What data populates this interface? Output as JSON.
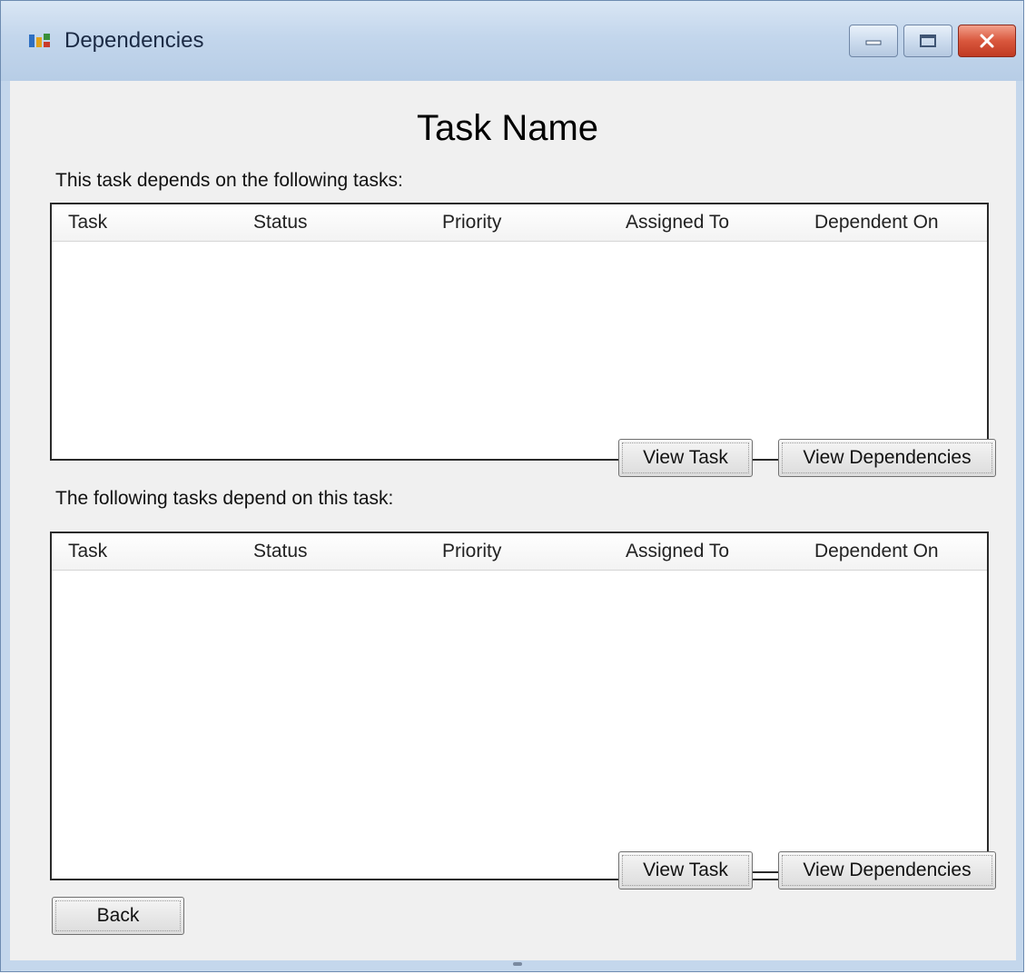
{
  "window": {
    "title": "Dependencies",
    "icon": "dependencies-app-icon",
    "controls": {
      "minimize": "minimize-icon",
      "maximize": "maximize-icon",
      "close": "close-icon"
    },
    "close_color": "#c8452b"
  },
  "heading": "Task Name",
  "upper_section": {
    "label": "This task depends on the following tasks:",
    "columns": [
      "Task",
      "Status",
      "Priority",
      "Assigned To",
      "Dependent On"
    ],
    "rows": [],
    "view_task_label": "View Task",
    "view_dependencies_label": "View Dependencies"
  },
  "lower_section": {
    "label": "The following tasks depend on this task:",
    "columns": [
      "Task",
      "Status",
      "Priority",
      "Assigned To",
      "Dependent On"
    ],
    "rows": [],
    "view_task_label": "View Task",
    "view_dependencies_label": "View Dependencies"
  },
  "back_label": "Back"
}
